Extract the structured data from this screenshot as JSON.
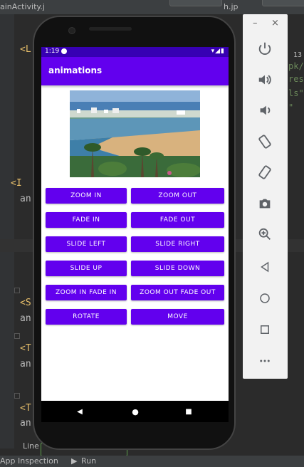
{
  "ide": {
    "tab_left": "ainActivity.j",
    "tab_right": "h.jp",
    "code_snippets": [
      "<L",
      "<I",
      "an",
      "<S",
      "an",
      "<T",
      "an",
      "<T",
      "an"
    ],
    "right_snippets": [
      "13",
      "pk/",
      "res-",
      "ls\"",
      "\""
    ],
    "bottom_line_label": "Line",
    "bottom_items": {
      "app_inspection": "App Inspection",
      "run": "Run"
    }
  },
  "emulator_toolbar": {
    "minimize": "–",
    "close": "×",
    "icons": [
      "power-icon",
      "volume-up-icon",
      "volume-down-icon",
      "rotate-left-icon",
      "rotate-right-icon",
      "camera-icon",
      "zoom-icon",
      "back-icon",
      "home-icon",
      "overview-icon",
      "more-icon"
    ]
  },
  "phone": {
    "status_time": "1:19",
    "status_icons": "▾◢▮",
    "app_title": "animations",
    "buttons": [
      {
        "left": "ZOOM IN",
        "right": "ZOOM OUT"
      },
      {
        "left": "FADE IN",
        "right": "FADE OUT"
      },
      {
        "left": "SLIDE LEFT",
        "right": "SLIDE RIGHT"
      },
      {
        "left": "SLIDE UP",
        "right": "SLIDE DOWN"
      },
      {
        "left": "ZOOM IN FADE IN",
        "right": "ZOOM OUT FADE OUT"
      },
      {
        "left": "ROTATE",
        "right": "MOVE"
      }
    ],
    "nav": {
      "back": "◀",
      "home": "●",
      "recents": "■"
    }
  },
  "colors": {
    "primary": "#6200ee",
    "status": "#3700b3"
  }
}
